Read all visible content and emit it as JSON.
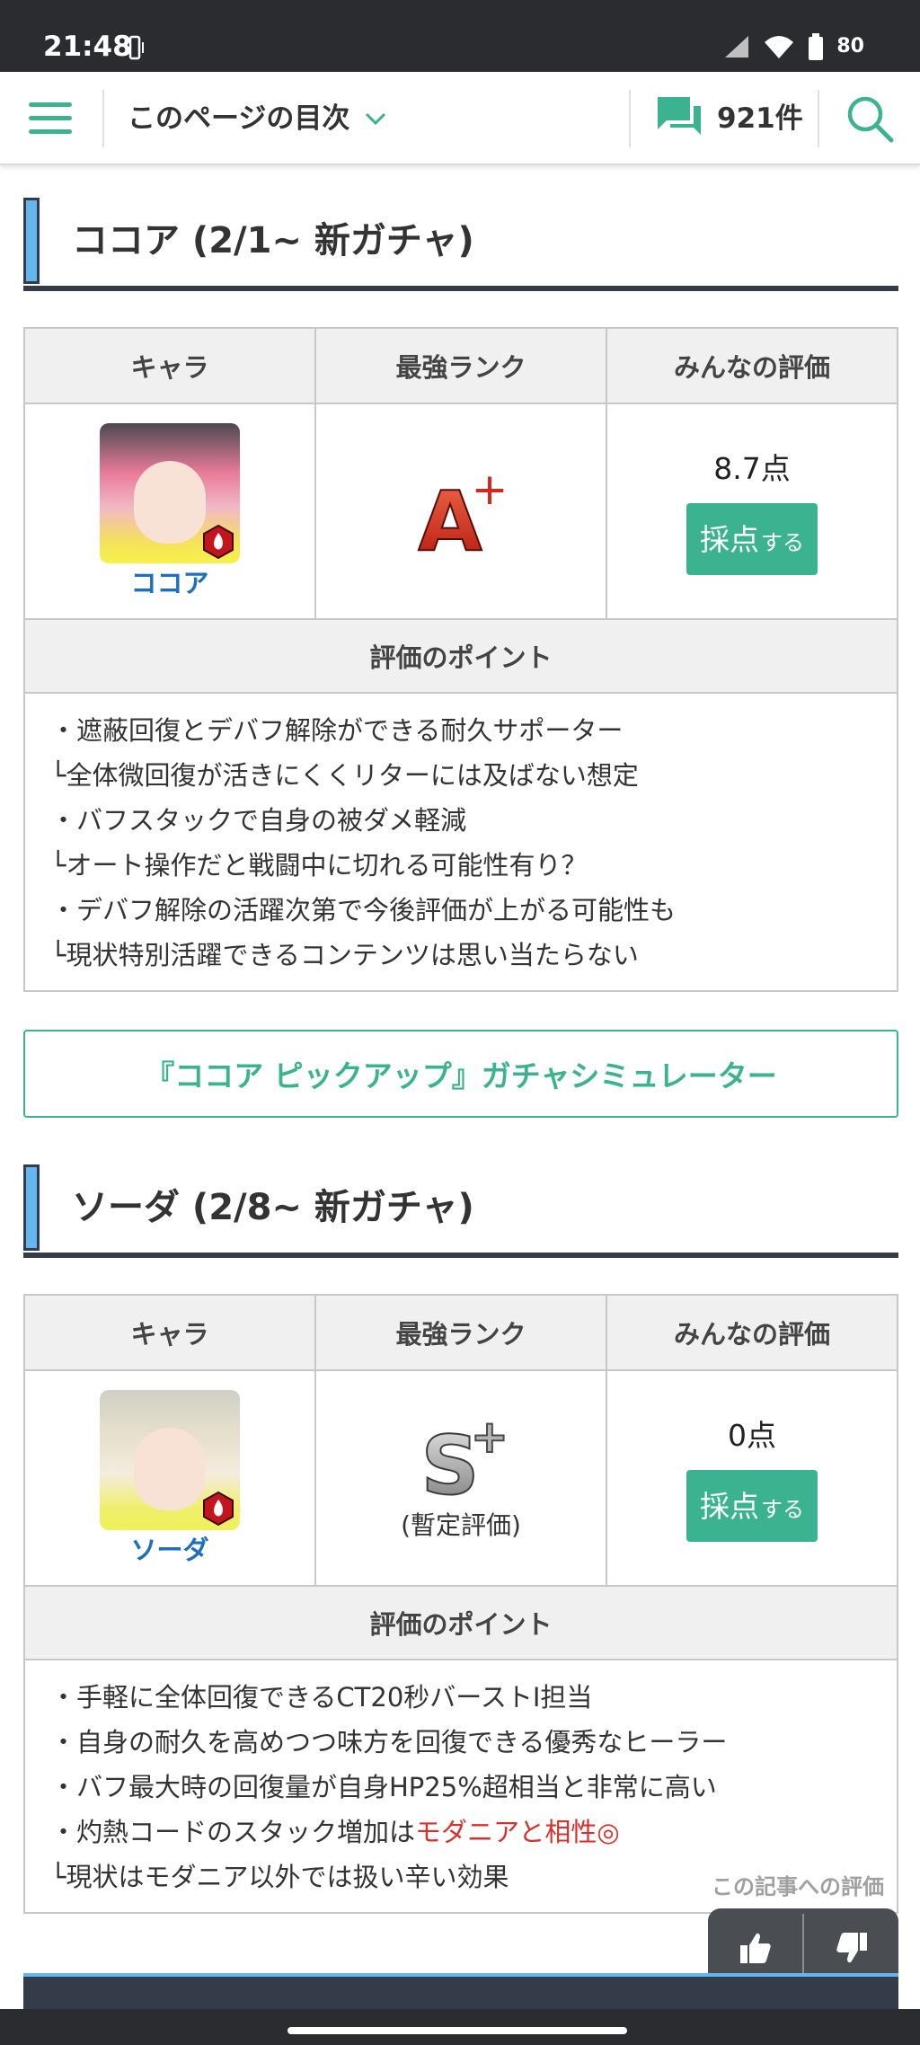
{
  "status_bar": {
    "time": "21:48",
    "battery": "80"
  },
  "header": {
    "toc_label": "このページの目次",
    "comment_count": "921件"
  },
  "sections": [
    {
      "heading": "ココア (2/1~ 新ガチャ)",
      "table": {
        "col_headers": [
          "キャラ",
          "最強ランク",
          "みんなの評価"
        ],
        "character_name": "ココア",
        "rank": "A+",
        "rank_note": "",
        "score": "8.7点",
        "rate_button_main": "採点",
        "rate_button_sub": "する",
        "points_header": "評価のポイント",
        "points": [
          "・遮蔽回復とデバフ解除ができる耐久サポーター",
          "└全体微回復が活きにくくリターには及ばない想定",
          "・バフスタックで自身の被ダメ軽減",
          "└オート操作だと戦闘中に切れる可能性有り？",
          "・デバフ解除の活躍次第で今後評価が上がる可能性も",
          "└現状特別活躍できるコンテンツは思い当たらない"
        ]
      }
    },
    {
      "heading": "ソーダ (2/8~ 新ガチャ)",
      "table": {
        "col_headers": [
          "キャラ",
          "最強ランク",
          "みんなの評価"
        ],
        "character_name": "ソーダ",
        "rank": "S+",
        "rank_note": "(暫定評価)",
        "score": "0点",
        "rate_button_main": "採点",
        "rate_button_sub": "する",
        "points_header": "評価のポイント",
        "points": [
          "・手軽に全体回復できるCT20秒バーストI担当",
          "・自身の耐久を高めつつ味方を回復できる優秀なヒーラー",
          "・バフ最大時の回復量が自身HP25%超相当と非常に高い"
        ],
        "point_highlight_prefix": "・灼熱コードのスタック増加は",
        "point_highlight_text": "モダニアと相性◎",
        "points_after": [
          "└現状はモダニア以外では扱い辛い効果"
        ]
      }
    }
  ],
  "gacha_button": "『ココア ピックアップ』ガチャシミュレーター",
  "article_rating_label": "この記事への評価",
  "colors": {
    "accent": "#3bb391",
    "link": "#1e6fbf",
    "heading_bar": "#63b7ee",
    "highlight": "#d9302c"
  },
  "icons": [
    "menu-icon",
    "chevron-down-icon",
    "comment-icon",
    "search-icon",
    "thumbs-up-icon",
    "thumbs-down-icon",
    "fire-element-icon"
  ]
}
